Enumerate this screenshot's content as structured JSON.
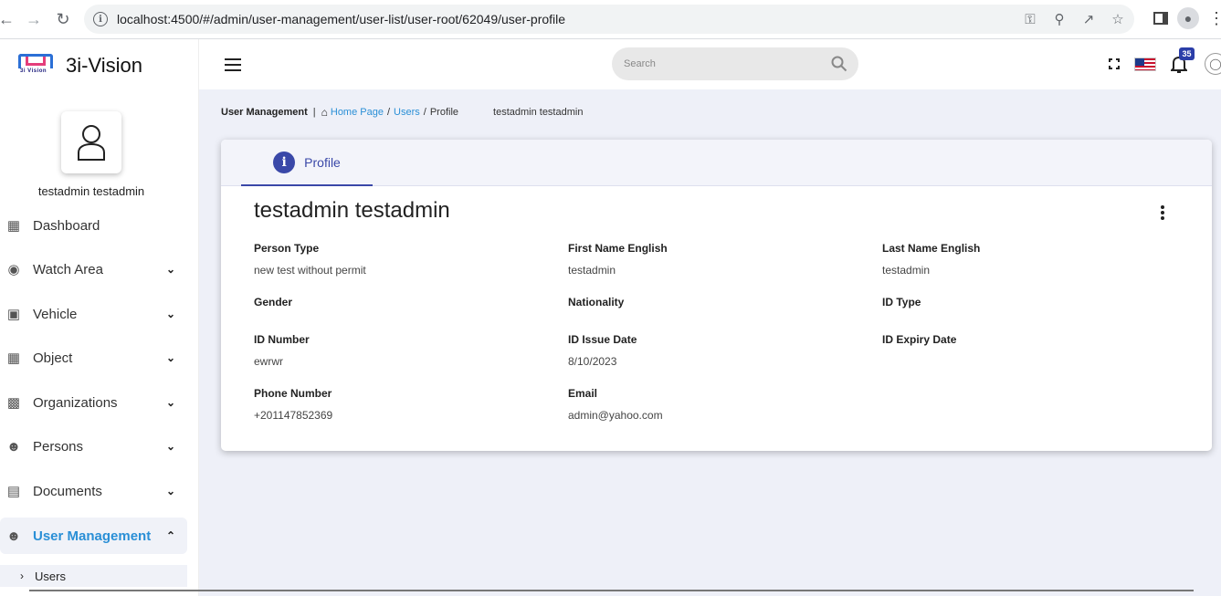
{
  "browser": {
    "url": "localhost:4500/#/admin/user-management/user-list/user-root/62049/user-profile"
  },
  "app": {
    "name": "3i-Vision",
    "logo_text": "3i Vision"
  },
  "sidebar": {
    "user_name": "testadmin testadmin",
    "items": [
      {
        "label": "Dashboard",
        "icon": "dashboard-icon",
        "expandable": false
      },
      {
        "label": "Watch Area",
        "icon": "watch-area-icon",
        "expandable": true
      },
      {
        "label": "Vehicle",
        "icon": "car-icon",
        "expandable": true
      },
      {
        "label": "Object",
        "icon": "object-icon",
        "expandable": true
      },
      {
        "label": "Organizations",
        "icon": "building-icon",
        "expandable": true
      },
      {
        "label": "Persons",
        "icon": "persons-icon",
        "expandable": true
      },
      {
        "label": "Documents",
        "icon": "document-icon",
        "expandable": true
      },
      {
        "label": "User Management",
        "icon": "user-group-icon",
        "expandable": true,
        "active": true
      }
    ],
    "sub_items": [
      {
        "label": "Users"
      }
    ]
  },
  "topbar": {
    "search_placeholder": "Search",
    "notification_count": "35"
  },
  "breadcrumb": {
    "section": "User Management",
    "home": "Home Page",
    "users": "Users",
    "current": "Profile",
    "who": "testadmin testadmin"
  },
  "profile": {
    "tab_label": "Profile",
    "name": "testadmin testadmin",
    "fields": {
      "person_type": {
        "label": "Person Type",
        "value": "new test without permit"
      },
      "first_name": {
        "label": "First Name English",
        "value": "testadmin"
      },
      "last_name": {
        "label": "Last Name English",
        "value": "testadmin"
      },
      "gender": {
        "label": "Gender",
        "value": ""
      },
      "nationality": {
        "label": "Nationality",
        "value": ""
      },
      "id_type": {
        "label": "ID Type",
        "value": ""
      },
      "id_number": {
        "label": "ID Number",
        "value": "ewrwr"
      },
      "id_issue_date": {
        "label": "ID Issue Date",
        "value": "8/10/2023"
      },
      "id_expiry_date": {
        "label": "ID Expiry Date",
        "value": ""
      },
      "phone": {
        "label": "Phone Number",
        "value": "+201147852369"
      },
      "email": {
        "label": "Email",
        "value": "admin@yahoo.com"
      }
    }
  },
  "colors": {
    "accent": "#3a48a8",
    "link": "#2a8fd6",
    "main_bg": "#eef0f8"
  }
}
